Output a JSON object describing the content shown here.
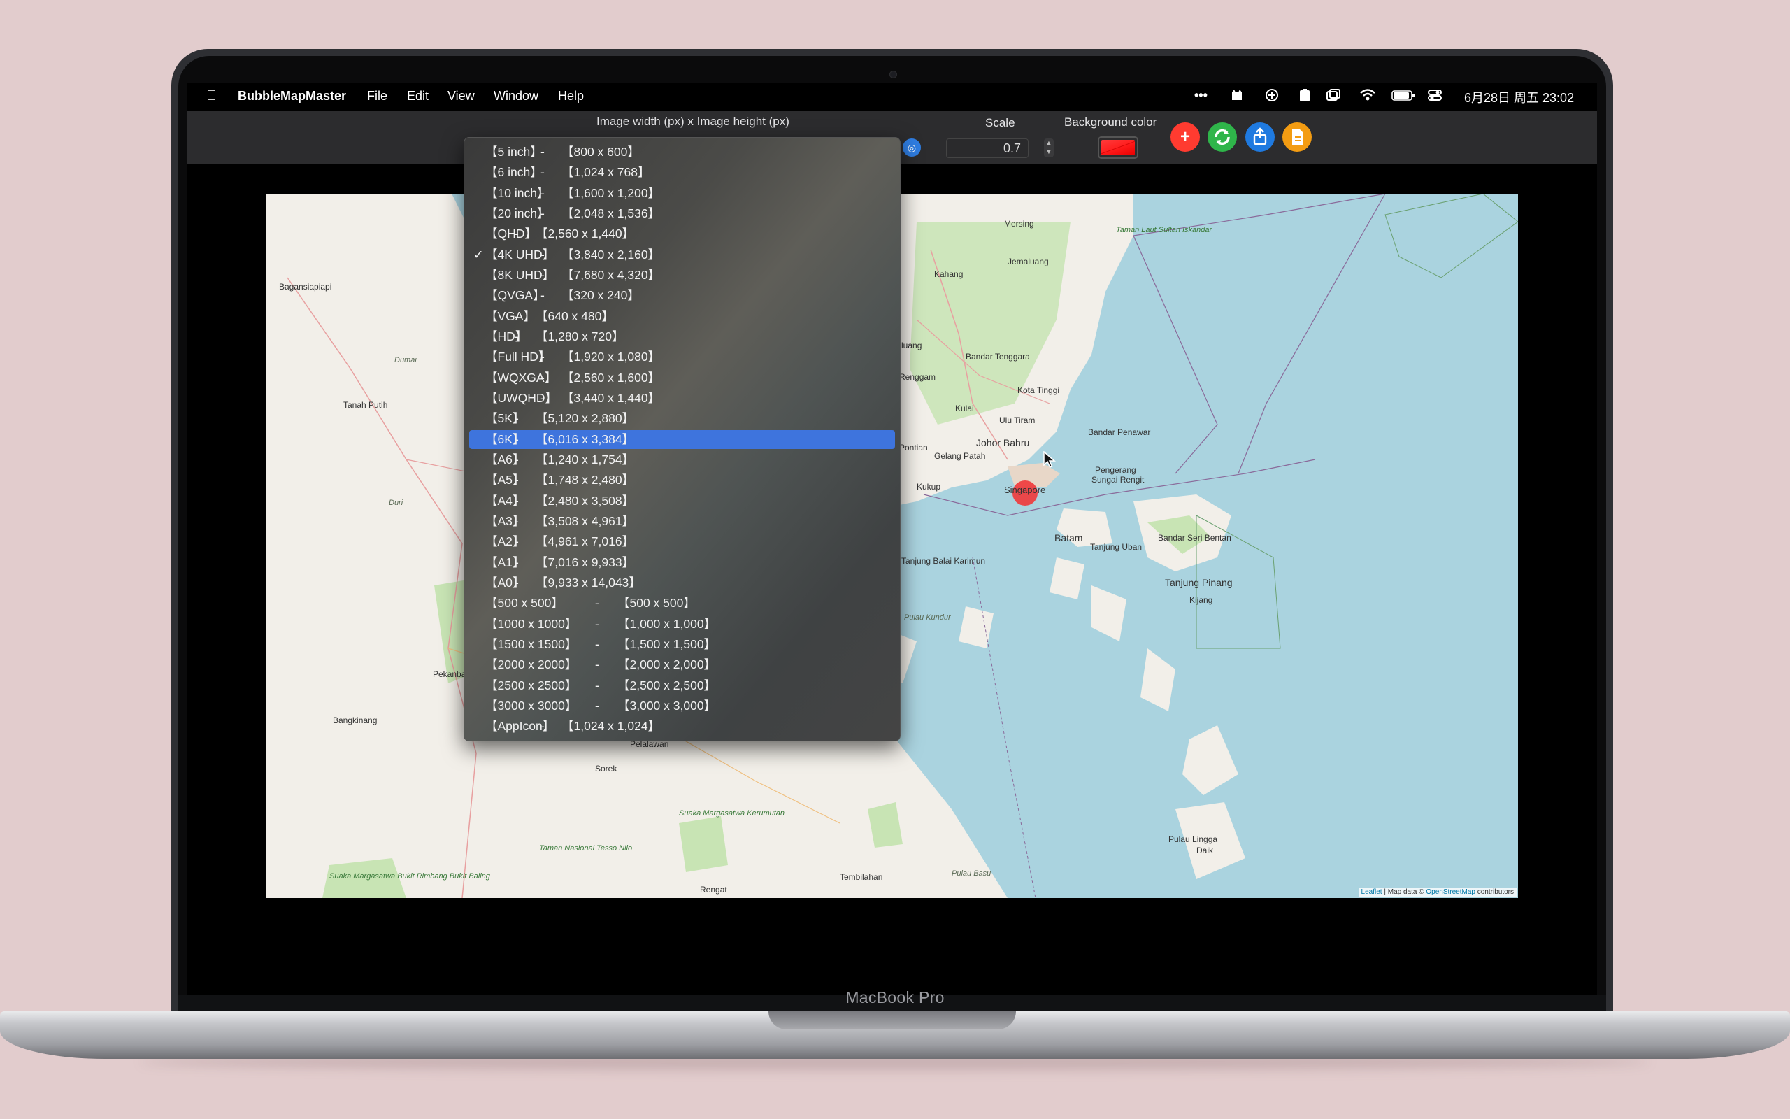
{
  "app": {
    "name": "BubbleMapMaster"
  },
  "menu": [
    "File",
    "Edit",
    "View",
    "Window",
    "Help"
  ],
  "status_bar": {
    "datetime": "6月28日 周五 23:02",
    "more": "•••"
  },
  "toolbar": {
    "size_label": "Image width (px)  x  Image height (px)",
    "scale_label": "Scale",
    "scale_value": "0.7",
    "bg_label": "Background color",
    "bg_color": "#ff1f1f"
  },
  "dropdown": {
    "selected_index": 14,
    "checked_index": 5,
    "items": [
      {
        "name": "【5 inch】",
        "size": "【800 x 600】"
      },
      {
        "name": "【6 inch】",
        "size": "【1,024 x 768】"
      },
      {
        "name": "【10 inch】",
        "size": "【1,600 x 1,200】"
      },
      {
        "name": "【20 inch】",
        "size": "【2,048 x 1,536】"
      },
      {
        "name": "【QHD】",
        "size": "【2,560 x 1,440】"
      },
      {
        "name": "【4K UHD】",
        "size": "【3,840 x 2,160】"
      },
      {
        "name": "【8K UHD】",
        "size": "【7,680 x 4,320】"
      },
      {
        "name": "【QVGA】",
        "size": "【320 x 240】"
      },
      {
        "name": "【VGA】",
        "size": "【640 x 480】"
      },
      {
        "name": "【HD】",
        "size": "【1,280 x 720】"
      },
      {
        "name": "【Full HD】",
        "size": "【1,920 x 1,080】"
      },
      {
        "name": "【WQXGA】",
        "size": "【2,560 x 1,600】"
      },
      {
        "name": "【UWQHD】",
        "size": "【3,440 x 1,440】"
      },
      {
        "name": "【5K】",
        "size": "【5,120 x 2,880】"
      },
      {
        "name": "【6K】",
        "size": "【6,016 x 3,384】"
      },
      {
        "name": "【A6】",
        "size": "【1,240 x 1,754】"
      },
      {
        "name": "【A5】",
        "size": "【1,748 x 2,480】"
      },
      {
        "name": "【A4】",
        "size": "【2,480 x 3,508】"
      },
      {
        "name": "【A3】",
        "size": "【3,508 x 4,961】"
      },
      {
        "name": "【A2】",
        "size": "【4,961 x 7,016】"
      },
      {
        "name": "【A1】",
        "size": "【7,016 x 9,933】"
      },
      {
        "name": "【A0】",
        "size": "【9,933 x 14,043】"
      },
      {
        "name": "【500 x 500】",
        "size": "【500 x 500】"
      },
      {
        "name": "【1000 x 1000】",
        "size": "【1,000 x 1,000】"
      },
      {
        "name": "【1500 x 1500】",
        "size": "【1,500 x 1,500】"
      },
      {
        "name": "【2000 x 2000】",
        "size": "【2,000 x 2,000】"
      },
      {
        "name": "【2500 x 2500】",
        "size": "【2,500 x 2,500】"
      },
      {
        "name": "【3000 x 3000】",
        "size": "【3,000 x 3,000】"
      },
      {
        "name": "【AppIcon】",
        "size": "【1,024 x 1,024】"
      }
    ]
  },
  "map": {
    "labels": [
      "Taman Laut Sultan Iskandar",
      "Mersing",
      "Kahang",
      "Jemaluang",
      "Kluang",
      "Renggam",
      "Bandar Tenggara",
      "Kulai",
      "Kota Tinggi",
      "Ulu Tiram",
      "Bandar Penawar",
      "Johor Bahru",
      "Pontian",
      "Gelang Patah",
      "Pengerang",
      "Sungai Rengit",
      "Kukup",
      "Singapore",
      "Batam",
      "Tanjung Uban",
      "Bandar Seri Bentan",
      "Tanjung Balai Karimun",
      "Tanjung Pinang",
      "Kijang",
      "Pulau Kundur",
      "Bagansiapiapi",
      "Dumai",
      "Tanah Putih",
      "Duri",
      "Pekanbaru",
      "Bangkinang",
      "Sorek",
      "Suaka Margasatwa Kerumutan",
      "Taman Nasional Tesso Nilo",
      "Suaka Margasatwa Bukit Rimbang Bukit Baling",
      "Tembilahan",
      "Pulau Basu",
      "Rengat",
      "Pulau Lingga",
      "Daik",
      "Pelalawan"
    ],
    "attribution_link1": "Leaflet",
    "attribution_mid": "| Map data ©",
    "attribution_link2": "OpenStreetMap",
    "attribution_end": "contributors"
  },
  "device_label": "MacBook Pro",
  "colors": {
    "selection": "#3e74dd",
    "add": "#ff3b30",
    "refresh": "#2fb54a",
    "share": "#1f7ae0",
    "export": "#f39c12",
    "marker": "#f0373a"
  }
}
